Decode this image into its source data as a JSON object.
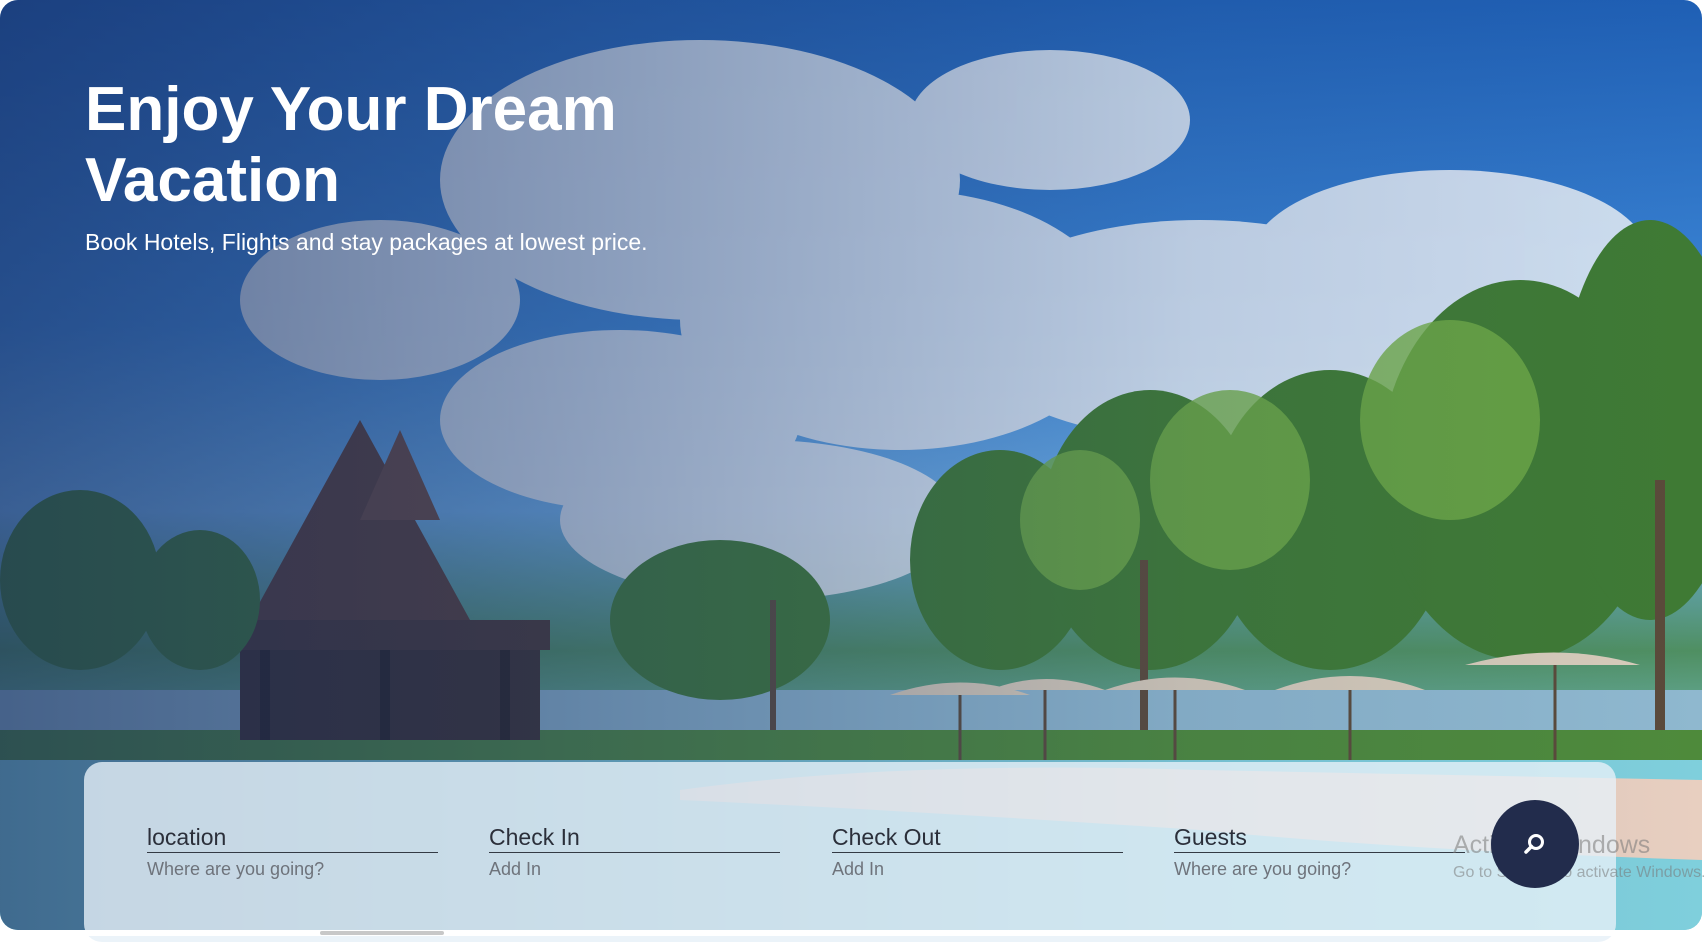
{
  "hero": {
    "title": "Enjoy Your Dream Vacation",
    "subtitle": "Book Hotels, Flights and stay packages at lowest price."
  },
  "search": {
    "fields": [
      {
        "label": "location",
        "placeholder": "Where are you going?"
      },
      {
        "label": "Check In",
        "placeholder": "Add In"
      },
      {
        "label": "Check Out",
        "placeholder": "Add In"
      },
      {
        "label": "Guests",
        "placeholder": "Where are you going?"
      }
    ],
    "button_icon": "search-icon"
  },
  "watermark": {
    "title": "Activate Windows",
    "subtitle": "Go to Settings to activate Windows."
  },
  "colors": {
    "search_button": "#222c4c",
    "panel": "#e6f0f7",
    "title_text": "#ffffff"
  }
}
